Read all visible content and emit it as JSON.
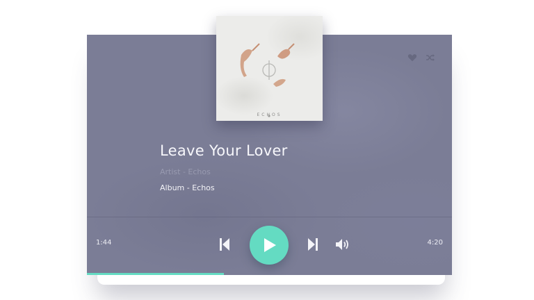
{
  "player": {
    "track_title": "Leave Your Lover",
    "artist_line": "Artist - Echos",
    "album_line": "Album - Echos",
    "album_art_text": "ECHOS",
    "time_elapsed": "1:44",
    "time_total": "4:20",
    "progress_fraction": 0.375,
    "is_playing": false,
    "accent_color": "#64dbc2",
    "background_color": "#7b7d96"
  },
  "icons": {
    "favorite": "heart-icon",
    "shuffle": "shuffle-icon",
    "previous": "skip-previous-icon",
    "play": "play-icon",
    "next": "skip-next-icon",
    "volume": "volume-icon"
  }
}
